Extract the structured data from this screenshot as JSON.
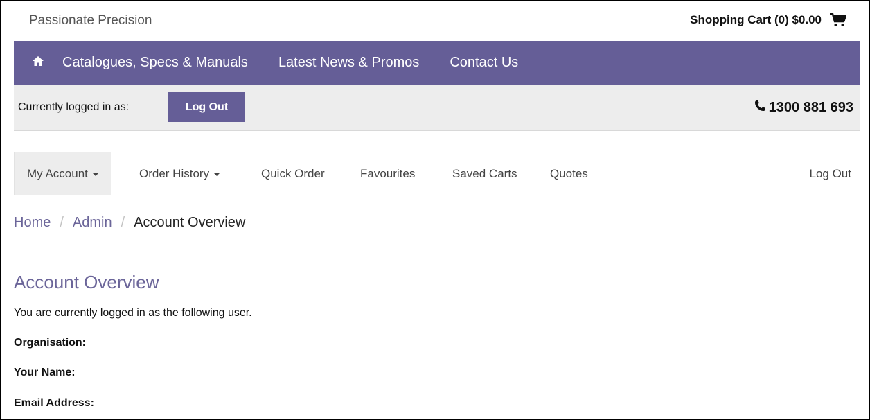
{
  "header": {
    "brand": "Passionate Precision",
    "cart_label": "Shopping Cart (0) $0.00",
    "cart_icon": "shopping-cart-icon"
  },
  "main_nav": {
    "home_icon": "home-icon",
    "items": [
      {
        "label": "Catalogues, Specs & Manuals"
      },
      {
        "label": "Latest News & Promos"
      },
      {
        "label": "Contact Us"
      }
    ]
  },
  "login_bar": {
    "label": "Currently logged in as:",
    "logout_label": "Log Out",
    "phone_icon": "phone-icon",
    "phone": "1300 881 693"
  },
  "account_nav": {
    "items": [
      {
        "label": "My Account",
        "dropdown": true,
        "active": true
      },
      {
        "label": "Order History",
        "dropdown": true
      },
      {
        "label": "Quick Order"
      },
      {
        "label": "Favourites"
      },
      {
        "label": "Saved Carts"
      },
      {
        "label": "Quotes"
      }
    ],
    "logout_label": "Log Out"
  },
  "breadcrumb": {
    "items": [
      "Home",
      "Admin"
    ],
    "current": "Account Overview"
  },
  "main": {
    "title": "Account Overview",
    "intro": "You are currently logged in as the following user.",
    "fields": [
      {
        "label": "Organisation:"
      },
      {
        "label": "Your Name:"
      },
      {
        "label": "Email Address:"
      }
    ]
  },
  "colors": {
    "brand_purple": "#655e97",
    "link_purple": "#6b6599",
    "bar_gray": "#ededed"
  }
}
